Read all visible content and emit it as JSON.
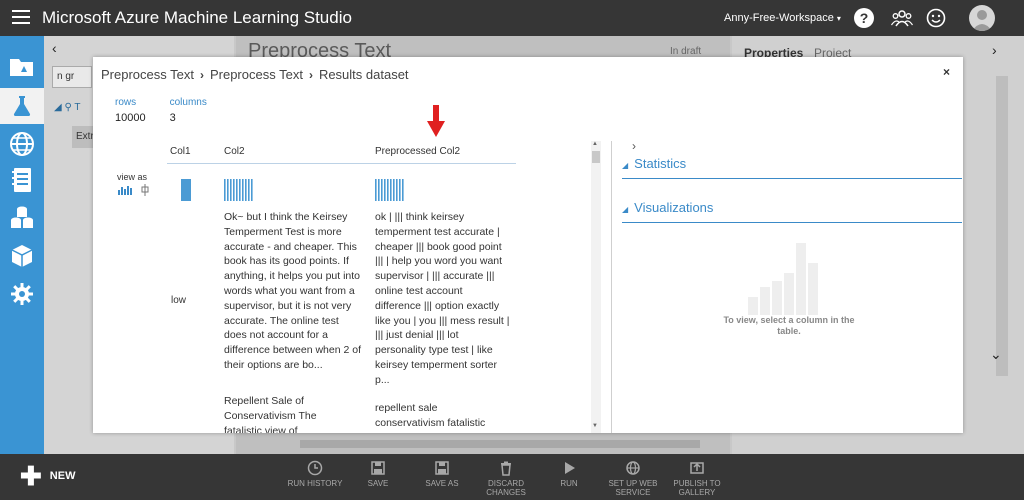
{
  "app": {
    "title": "Microsoft Azure Machine Learning Studio",
    "workspace": "Anny-Free-Workspace",
    "workspace_caret": "▾",
    "help": "?"
  },
  "background": {
    "palette_search": "n gr",
    "palette_item": "Extr",
    "experiment_title": "Preprocess Text",
    "experiment_status": "In draft",
    "props_tab_1": "Properties",
    "props_tab_2": "Project"
  },
  "modal": {
    "breadcrumb": [
      "Preprocess Text",
      "Preprocess Text",
      "Results dataset"
    ],
    "close": "×",
    "stats": {
      "rows_label": "rows",
      "rows_value": "10000",
      "columns_label": "columns",
      "columns_value": "3"
    },
    "view_as": "view as",
    "columns": [
      "Col1",
      "Col2",
      "Preprocessed Col2"
    ],
    "col1_row1": "low",
    "col2_row1": "Ok~ but I think the Keirsey Temperment Test is more accurate - and cheaper. This book has its good points. If anything, it helps you put into words what you want from a supervisor, but it is not very accurate. The online test does not account for a difference between when 2 of their options are bo...",
    "col2_row2": "Repellent Sale of Conservativism The fatalistic view of",
    "pre_row1": "ok | ||| think keirsey temperment test accurate | cheaper ||| book good point ||| | help you word you want supervisor | ||| accurate ||| online test account difference ||| option exactly like you | you ||| mess result | ||| just denial ||| lot personality type test | like keirsey temperment sorter p...",
    "pre_row2": "repellent sale conservativism fatalistic",
    "panel": {
      "statistics": "Statistics",
      "visualizations": "Visualizations",
      "hint": "To view, select a column in the table."
    }
  },
  "toolbar": {
    "new_label": "NEW",
    "items": [
      "RUN HISTORY",
      "SAVE",
      "SAVE AS",
      "DISCARD CHANGES",
      "RUN",
      "SET UP WEB SERVICE",
      "PUBLISH TO GALLERY"
    ]
  },
  "colors": {
    "topbar": "#363636",
    "nav": "#3a94d3",
    "accent": "#3a8ac8",
    "arrow": "#e02020"
  }
}
